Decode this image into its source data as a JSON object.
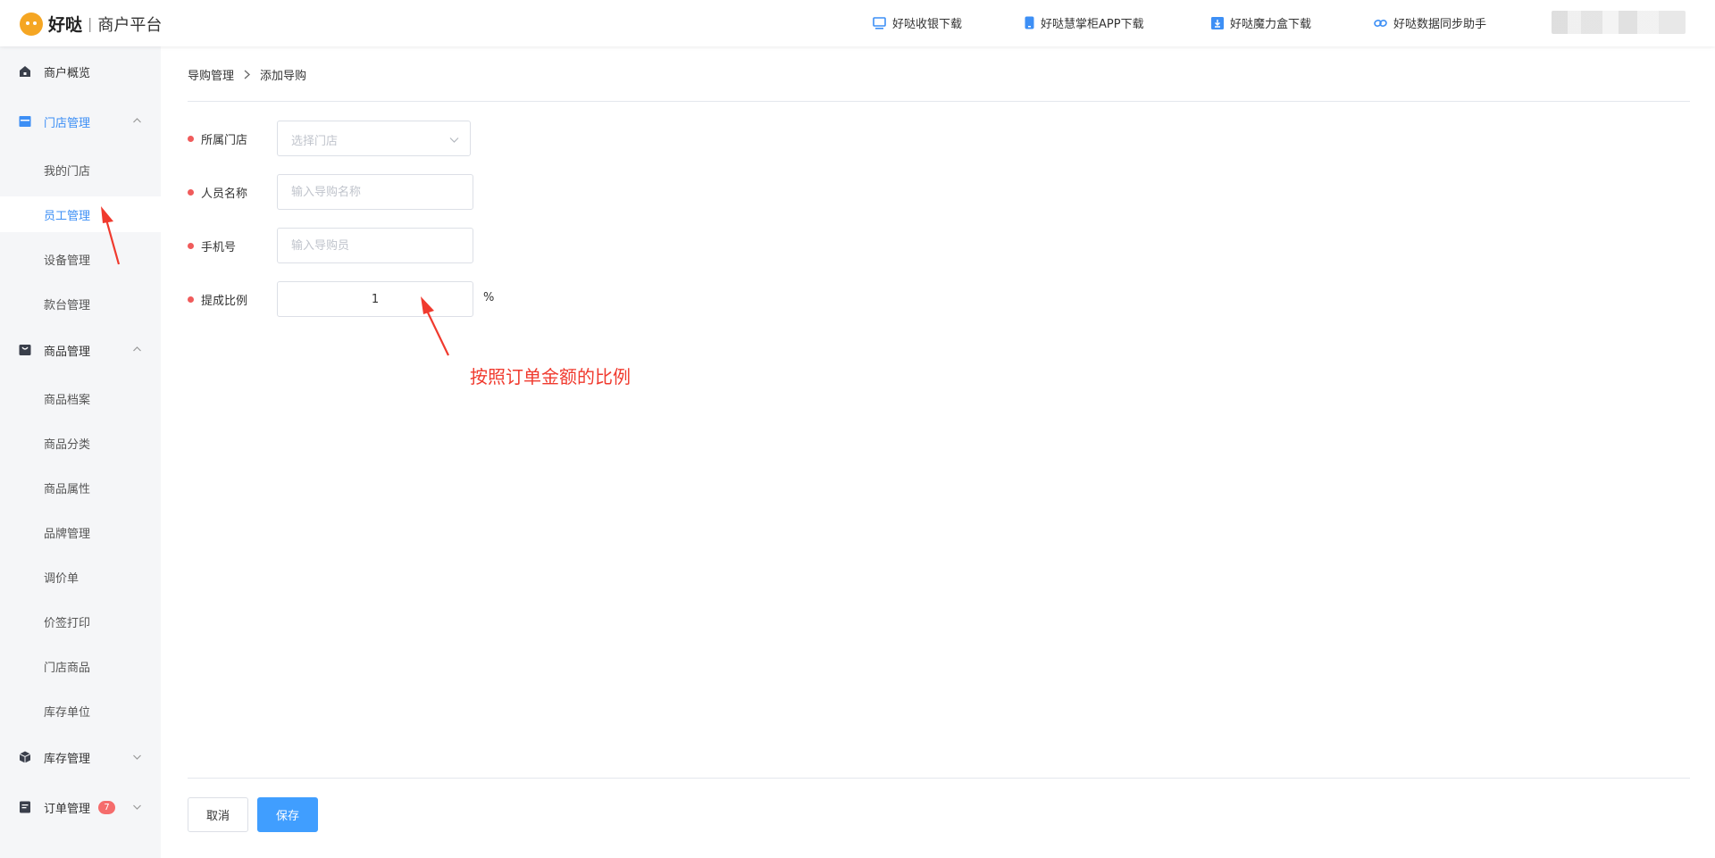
{
  "header": {
    "brand": "好哒",
    "separator": "|",
    "platform": "商户平台",
    "links": [
      {
        "label": "好哒收银下载",
        "icon": "monitor-icon"
      },
      {
        "label": "好哒慧掌柜APP下载",
        "icon": "phone-icon"
      },
      {
        "label": "好哒魔力盒下载",
        "icon": "download-icon"
      },
      {
        "label": "好哒数据同步助手",
        "icon": "link-icon"
      }
    ]
  },
  "sidebar": {
    "overview": "商户概览",
    "store_mgmt": "门店管理",
    "store_items": [
      "我的门店",
      "员工管理",
      "设备管理",
      "款台管理"
    ],
    "goods_mgmt": "商品管理",
    "goods_items": [
      "商品档案",
      "商品分类",
      "商品属性",
      "品牌管理",
      "调价单",
      "价签打印",
      "门店商品",
      "库存单位"
    ],
    "inventory_mgmt": "库存管理",
    "order_mgmt": "订单管理",
    "order_badge": "7"
  },
  "breadcrumb": {
    "parent": "导购管理",
    "separator": ">",
    "current": "添加导购"
  },
  "form": {
    "store_label": "所属门店",
    "store_placeholder": "选择门店",
    "name_label": "人员名称",
    "name_placeholder": "输入导购名称",
    "phone_label": "手机号",
    "phone_placeholder": "输入导购员",
    "ratio_label": "提成比例",
    "ratio_value": "1",
    "ratio_unit": "%"
  },
  "annotation": "按照订单金额的比例",
  "actions": {
    "cancel": "取消",
    "save": "保存"
  },
  "colors": {
    "accent": "#409eff",
    "required_dot": "#f05b5b",
    "annotation": "#f03a2e",
    "logo": "#f5a623"
  }
}
